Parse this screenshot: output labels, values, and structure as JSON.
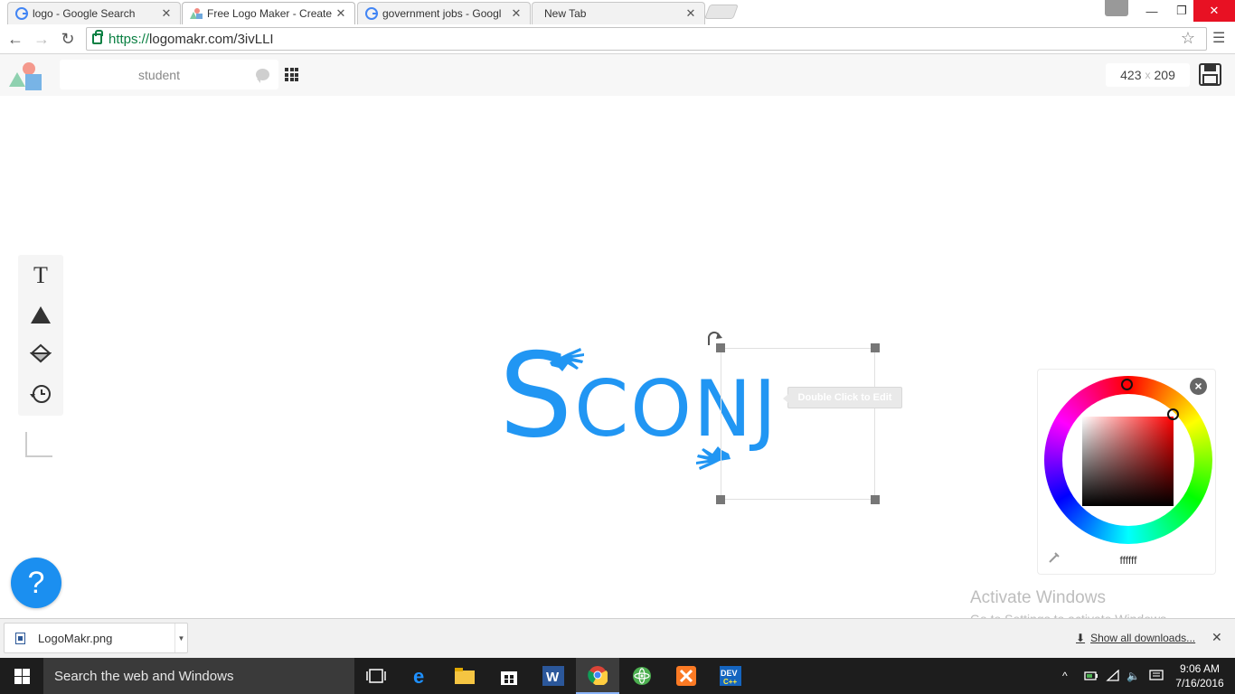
{
  "browser": {
    "tabs": [
      {
        "title": "logo - Google Search",
        "favicon": "google-icon"
      },
      {
        "title": "Free Logo Maker - Create",
        "favicon": "logomakr-icon",
        "active": true
      },
      {
        "title": "government jobs - Googl",
        "favicon": "google-icon"
      },
      {
        "title": "New Tab",
        "favicon": ""
      }
    ],
    "url_scheme": "https://",
    "url_rest": "logomakr.com/3ivLLI"
  },
  "logomakr": {
    "search_value": "student",
    "canvas_width": "423",
    "canvas_sep": "x",
    "canvas_height": "209",
    "logo": {
      "big_letter": "S",
      "rest": "CONJ",
      "color": "#2196f3"
    },
    "tooltip": "Double Click to Edit",
    "color_picker": {
      "hex": "ffffff"
    },
    "help": "?"
  },
  "watermark": {
    "title": "Activate Windows",
    "subtitle": "Go to Settings to activate Windows."
  },
  "downloads": {
    "file": "LogoMakr.png",
    "show_all": "Show all downloads..."
  },
  "taskbar": {
    "search_placeholder": "Search the web and Windows",
    "time": "9:06 AM",
    "date": "7/16/2016"
  }
}
